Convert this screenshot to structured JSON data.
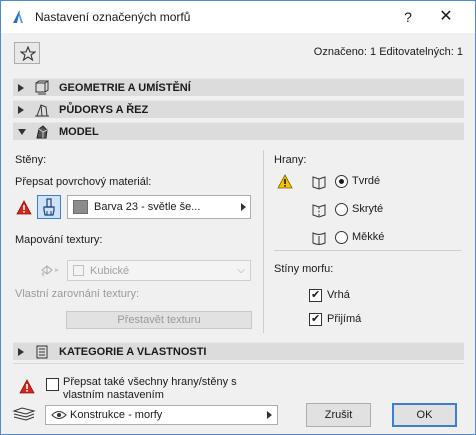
{
  "window": {
    "title": "Nastavení označených morfů",
    "help_label": "?",
    "close_label": "✕"
  },
  "header": {
    "selected_info": "Označeno: 1 Editovatelných: 1"
  },
  "sections": [
    {
      "label": "GEOMETRIE A UMÍSTĚNÍ",
      "expanded": false
    },
    {
      "label": "PŮDORYS A ŘEZ",
      "expanded": false
    },
    {
      "label": "MODEL",
      "expanded": true
    },
    {
      "label": "KATEGORIE A VLASTNOSTI",
      "expanded": false
    }
  ],
  "model": {
    "walls_label": "Stěny:",
    "override_material_label": "Přepsat povrchový materiál:",
    "material_value": "Barva 23 - světle še...",
    "texture_mapping_label": "Mapování textury:",
    "texture_mapping_value": "Kubické",
    "custom_alignment_label": "Vlastní zarovnání textury:",
    "rebuild_texture_label": "Přestavět texturu",
    "edges_label": "Hrany:",
    "edge_options": [
      {
        "label": "Tvrdé",
        "selected": true
      },
      {
        "label": "Skryté",
        "selected": false
      },
      {
        "label": "Měkké",
        "selected": false
      }
    ],
    "shadows_label": "Stíny morfu:",
    "shadow_options": [
      {
        "label": "Vrhá",
        "checked": true
      },
      {
        "label": "Přijímá",
        "checked": true
      }
    ]
  },
  "footer": {
    "override_edges_line1": "Přepsat také všechny hrany/stěny s",
    "override_edges_line2": "vlastním nastavením",
    "override_edges_checked": false,
    "layer_value": "Konstrukce - morfy",
    "cancel_label": "Zrušit",
    "ok_label": "OK"
  },
  "colors": {
    "accent": "#3c7fd1",
    "warning": "#f5c400",
    "error": "#d9261c",
    "section_bg": "#dcdcdc"
  }
}
